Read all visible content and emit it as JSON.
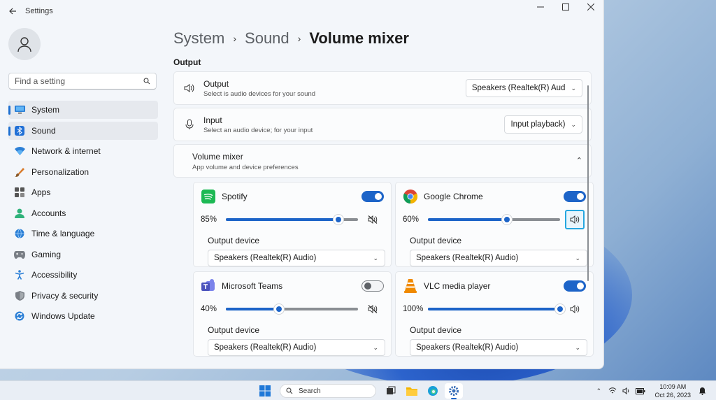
{
  "window": {
    "title": "Settings"
  },
  "search": {
    "placeholder": "Find a setting"
  },
  "sidebar": {
    "items": [
      {
        "label": "System",
        "icon": "monitor-icon",
        "active": true
      },
      {
        "label": "Sound",
        "icon": "bluetooth-icon",
        "active": true
      },
      {
        "label": "Network & internet",
        "icon": "wifi-icon"
      },
      {
        "label": "Personalization",
        "icon": "brush-icon"
      },
      {
        "label": "Apps",
        "icon": "apps-icon"
      },
      {
        "label": "Accounts",
        "icon": "person-icon"
      },
      {
        "label": "Time & language",
        "icon": "globe-clock-icon"
      },
      {
        "label": "Gaming",
        "icon": "gamepad-icon"
      },
      {
        "label": "Accessibility",
        "icon": "accessibility-icon"
      },
      {
        "label": "Privacy & security",
        "icon": "shield-icon"
      },
      {
        "label": "Windows Update",
        "icon": "update-icon"
      }
    ]
  },
  "breadcrumb": {
    "part1": "System",
    "part2": "Sound",
    "current": "Volume mixer",
    "sep": "›"
  },
  "output_section": {
    "label": "Output"
  },
  "output_row": {
    "title": "Output",
    "subtitle": "Select is audio devices for your sound",
    "value": "Speakers (Realtek(R) Aud"
  },
  "input_row": {
    "title": "Input",
    "subtitle": "Select an audio device; for your input",
    "value": "Input playback)"
  },
  "mixer": {
    "title": "Volume mixer",
    "subtitle": "App volume and device preferences"
  },
  "apps": [
    {
      "name": "Spotify",
      "volume_label": "85%",
      "volume": 0.85,
      "enabled": true,
      "muted": true,
      "output_label": "Output device",
      "device": "Speakers (Realtek(R) Audio)",
      "color": "#1db954"
    },
    {
      "name": "Google Chrome",
      "volume_label": "60%",
      "volume": 0.6,
      "enabled": true,
      "muted": false,
      "output_label": "Output device",
      "device": "Speakers (Realtek(R) Audio)",
      "color": "#4285f4"
    },
    {
      "name": "Microsoft Teams",
      "volume_label": "40%",
      "volume": 0.4,
      "enabled": false,
      "muted": true,
      "output_label": "Output device",
      "device": "Speakers (Realtek(R) Audio)",
      "color": "#5b5fc7"
    },
    {
      "name": "VLC media player",
      "volume_label": "100%",
      "volume": 1.0,
      "enabled": true,
      "muted": false,
      "output_label": "Output device",
      "device": "Speakers (Realtek(R) Audio)",
      "color": "#f08a00"
    }
  ],
  "taskbar": {
    "search_label": "Search",
    "time": "10:09 AM",
    "date": "Oct 26, 2023"
  },
  "colors": {
    "accent": "#1d64c8",
    "focus": "#25a7e0"
  }
}
